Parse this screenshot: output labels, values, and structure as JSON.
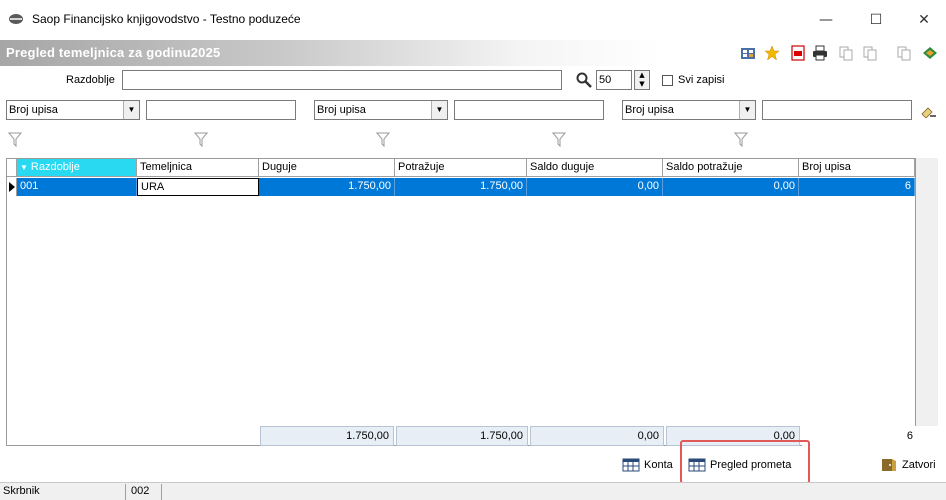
{
  "window": {
    "title": "Saop Financijsko knjigovodstvo - Testno poduzeće",
    "minimize": "—",
    "maximize": "☐",
    "close": "✕"
  },
  "header": {
    "title": "Pregled temeljnica za godinu2025"
  },
  "toolbar_icons": [
    "grid-icon",
    "star-icon",
    "pdf-icon",
    "print-icon",
    "copy-icon",
    "paste-icon",
    "book-icon"
  ],
  "filter": {
    "razdoblje_label": "Razdoblje",
    "razdoblje_value": "",
    "count_value": "50",
    "svi_zapisi_label": "Svi zapisi",
    "selects": [
      "Broj upisa",
      "Broj upisa",
      "Broj upisa"
    ]
  },
  "grid": {
    "columns": [
      "Razdoblje",
      "Temeljnica",
      "Duguje",
      "Potražuje",
      "Saldo duguje",
      "Saldo potražuje",
      "Broj upisa"
    ],
    "rows": [
      [
        "001",
        "URA",
        "1.750,00",
        "1.750,00",
        "0,00",
        "0,00",
        "6"
      ]
    ],
    "totals": [
      "1.750,00",
      "1.750,00",
      "0,00",
      "0,00",
      "6"
    ]
  },
  "buttons": {
    "konta": "Konta",
    "pregled_prometa": "Pregled prometa",
    "zatvori": "Zatvori"
  },
  "status": {
    "user": "Skrbnik",
    "code": "002"
  },
  "colors": {
    "selection": "#0078d7",
    "active_header": "#29d9f2",
    "highlight_box": "#e05a5a"
  }
}
